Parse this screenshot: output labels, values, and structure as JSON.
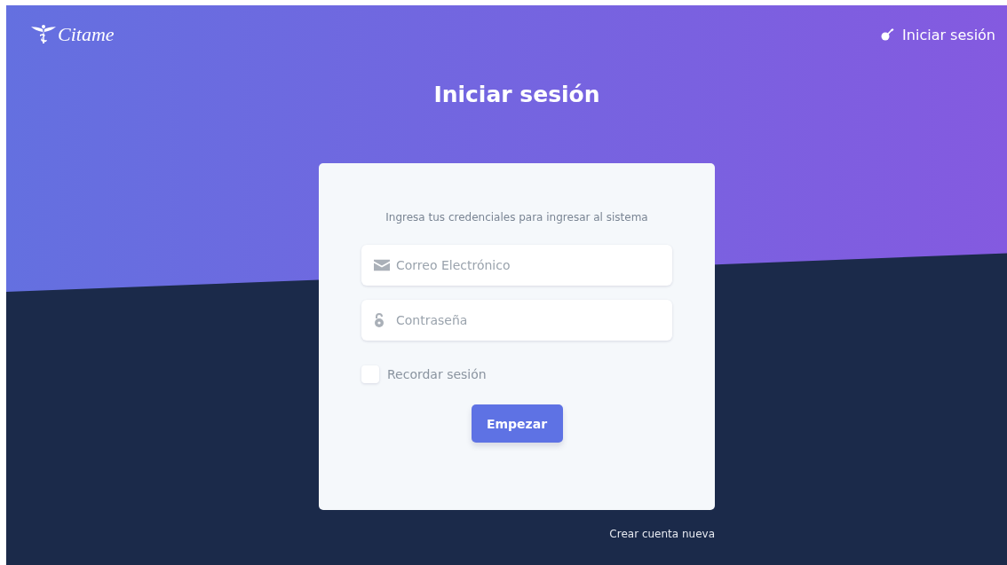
{
  "header": {
    "logo": "Citame",
    "login_link": "Iniciar sesión"
  },
  "title": "Iniciar sesión",
  "card": {
    "subtitle": "Ingresa tus credenciales para ingresar al sistema",
    "fields": [
      {
        "kind": "email",
        "placeholder": "Correo Electrónico"
      },
      {
        "kind": "password",
        "placeholder": "Contraseña"
      }
    ],
    "remember": {
      "label": "Recordar sesión",
      "checked": false
    },
    "submit": "Empezar"
  },
  "footer_link": "Crear cuenta nueva"
}
